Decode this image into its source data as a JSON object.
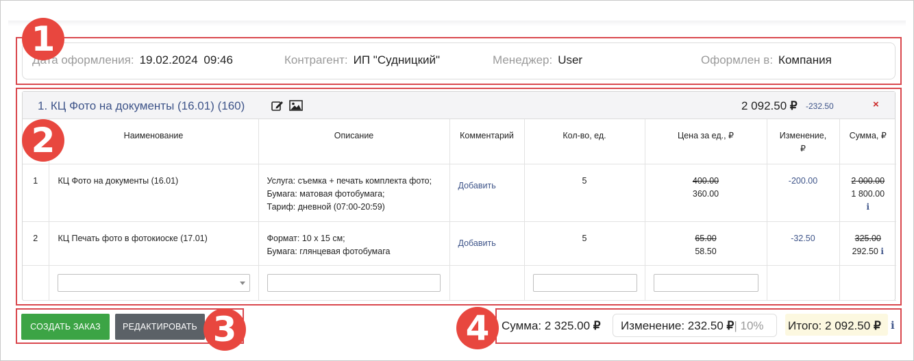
{
  "header": {
    "order_date_label": "Дата оформления:",
    "order_date_value": "19.02.2024",
    "order_time_value": "09:46",
    "counterparty_label": "Контрагент:",
    "counterparty_value": "ИП \"Судницкий\"",
    "manager_label": "Менеджер:",
    "manager_value": "User",
    "placed_in_label": "Оформлен в:",
    "placed_in_value": "Компания"
  },
  "annotations": [
    "1",
    "2",
    "3",
    "4"
  ],
  "position": {
    "title": "1. КЦ Фото на документы (16.01) (160)",
    "total": "2 092.50",
    "currency": "₽",
    "change": "-232.50",
    "delete_icon": "×",
    "icons": [
      "edit-icon",
      "image-icon"
    ]
  },
  "table": {
    "headers": [
      "Наименование",
      "Описание",
      "Комментарий",
      "Кол-во, ед.",
      "Цена за ед., ₽",
      "Изменение,",
      "₽",
      "Сумма, ₽"
    ],
    "rows": [
      {
        "num": "1",
        "name": "КЦ Фото на документы (16.01)",
        "desc": [
          "Услуга: съемка + печать комплекта фото;",
          "Бумага: матовая фотобумага;",
          "Тариф: дневной (07:00-20:59)"
        ],
        "comment": "Добавить",
        "qty": "5",
        "price_old": "400.00",
        "price_new": "360.00",
        "change": "-200.00",
        "sum_old": "2 000.00",
        "sum_new": "1 800.00",
        "info": "i"
      },
      {
        "num": "2",
        "name": "КЦ Печать фото в фотокиоске (17.01)",
        "desc": [
          "Формат: 10 х 15 см;",
          "Бумага: глянцевая фотобумага"
        ],
        "comment": "Добавить",
        "qty": "5",
        "price_old": "65.00",
        "price_new": "58.50",
        "change": "-32.50",
        "sum_old": "325.00",
        "sum_new": "292.50",
        "info": "i"
      }
    ]
  },
  "buttons": {
    "create": "СОЗДАТЬ ЗАКАЗ",
    "edit": "РЕДАКТИРОВАТЬ"
  },
  "totals": {
    "sum_label": "Сумма:",
    "sum_value": "2 325.00",
    "change_label": "Изменение:",
    "change_value": "232.50",
    "change_percent": "| 10%",
    "final_label": "Итого:",
    "final_value": "2 092.50",
    "currency": "₽",
    "info": "i"
  },
  "colors": {
    "annotation_red": "#d9474d",
    "badge_red": "#e8473f",
    "link_blue": "#3e5489",
    "create_green": "#3ca445",
    "edit_gray": "#5b6167",
    "final_highlight": "#fcf8e0"
  }
}
